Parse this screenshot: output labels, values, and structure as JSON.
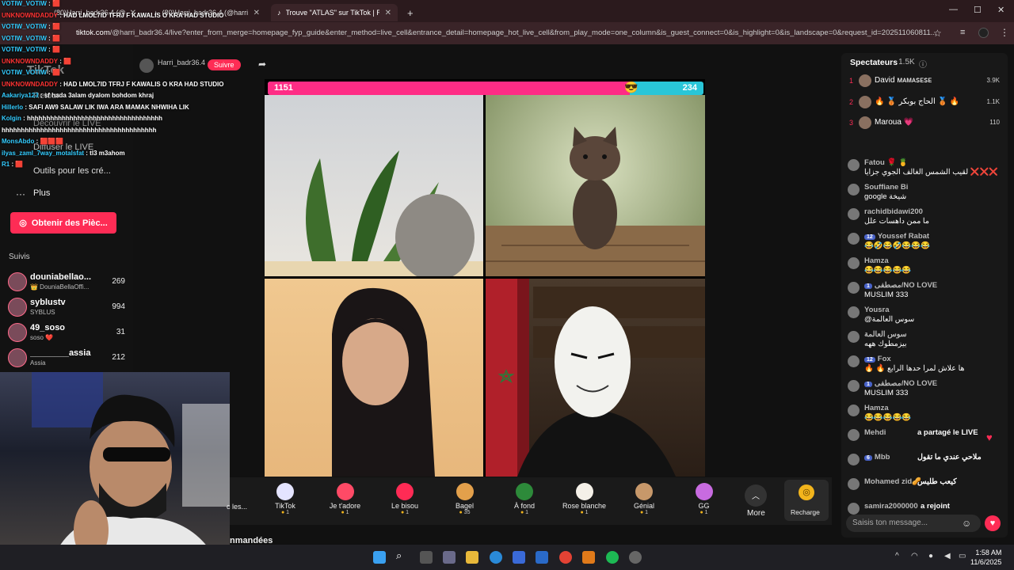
{
  "browser": {
    "tabs": [
      {
        "label": "(80)Harri_badr36.4 (@harri_badr"
      },
      {
        "label": "(80)Harri_badr36.4 (@harri_bad"
      },
      {
        "label": "Trouve \"ATLAS\" sur TikTok | Rech"
      }
    ],
    "url_host": "tiktok.com",
    "url_rest": "/@harri_badr36.4/live?enter_from_merge=homepage_fyp_guide&enter_method=live_cell&entrance_detail=homepage_hot_live_cell&from_play_mode=one_column&is_guest_connect=0&is_highlight=0&is_landscape=0&request_id=202511060811..."
  },
  "sidebar": {
    "logo": "TikTok",
    "back": "Retour",
    "discover": "Découvrir le LIVE",
    "broadcast": "Diffuser le LIVE",
    "tools": "Outils pour les cré...",
    "more": "Plus",
    "coins_button": "Obtenir des Pièc...",
    "following_title": "Suivis",
    "following": [
      {
        "name": "douniabellao...",
        "sub": "👑 DouniaBellaOffi...",
        "count": "269"
      },
      {
        "name": "syblustv",
        "sub": "SYBLUS",
        "count": "994"
      },
      {
        "name": "49_soso",
        "sub": "soso ❤️",
        "count": "31"
      },
      {
        "name": "________assia",
        "sub": "Assia",
        "count": "212"
      }
    ]
  },
  "overlay_chat": [
    {
      "user": "VOTIW_VOTIW",
      "msg": ": 🟥",
      "red": false
    },
    {
      "user": "UNKNOWNDADDY",
      "msg": ": HAD LMOL7ID TFRJ F KAWALIS O KRA HAD STUDIO",
      "red": true
    },
    {
      "user": "VOTIW_VOTIW",
      "msg": ": 🟥",
      "red": false
    },
    {
      "user": "VOTIW_VOTIW",
      "msg": ": 🟥",
      "red": false
    },
    {
      "user": "VOTIW_VOTIW",
      "msg": ": 🟥",
      "red": false
    },
    {
      "user": "UNKNOWNDADDY",
      "msg": ": 🟥",
      "red": true
    },
    {
      "user": "VOTIW_VOTIW",
      "msg": ": 🟥",
      "red": false
    },
    {
      "user": "UNKNOWNDADDY",
      "msg": ": HAD LMOL7ID TFRJ F KAWALIS O KRA HAD STUDIO",
      "red": true
    },
    {
      "user": "Aakariya123",
      "msg": ": sf hada 3alam dyalom bohdom khraj",
      "red": false
    },
    {
      "user": "Hillerlo",
      "msg": ": SAFI AW9 SALAW LIK IWA ARA MAMAK NHWIHA LIK",
      "red": false
    },
    {
      "user": "Kolgin",
      "msg": ": hhhhhhhhhhhhhhhhhhhhhhhhhhhhhhhhhhh",
      "red": false
    },
    {
      "user": "",
      "msg": "hhhhhhhhhhhhhhhhhhhhhhhhhhhhhhhhhhhhhhhh",
      "red": false
    },
    {
      "user": "MonsAbdo",
      "msg": ": 🟥🟥🟥",
      "red": false
    },
    {
      "user": "ilyas_zaml_7way_motalsfat",
      "msg": ": tl3 m3ahom",
      "red": false
    },
    {
      "user": "R1",
      "msg": ": 🟥",
      "red": false
    }
  ],
  "stream": {
    "host": "Harri_badr36.4",
    "follow_label": "Suivre",
    "score_left": "1151",
    "score_right": "234",
    "score_left_fraction": 0.83
  },
  "gifts": [
    {
      "name": "TikTok",
      "price": "1",
      "color": "#e4e4ff"
    },
    {
      "name": "Je t'adore",
      "price": "1",
      "color": "#ff4a66"
    },
    {
      "name": "Le bisou",
      "price": "1",
      "color": "#ff2b55"
    },
    {
      "name": "Bagel",
      "price": "35",
      "color": "#e3a04b"
    },
    {
      "name": "À fond",
      "price": "1",
      "color": "#2d8a3a"
    },
    {
      "name": "Rose blanche",
      "price": "1",
      "color": "#f4f0e8"
    },
    {
      "name": "Génial",
      "price": "1",
      "color": "#c7986a"
    },
    {
      "name": "GG",
      "price": "1",
      "color": "#c86be0"
    }
  ],
  "gift_partial": "c les...",
  "more_label": "More",
  "recharge_label": "Recharge",
  "bottom_text": "nmandées",
  "viewers": {
    "title": "Spectateurs",
    "count": "1.5K",
    "top": [
      {
        "rank": "1",
        "name": "David ᴍᴀᴍᴀꜱᴇꜱᴇ",
        "score": "3.9K"
      },
      {
        "rank": "2",
        "name": "🔥 🥉 الحاج بوبكر 🥉 🔥",
        "score": "1.1K"
      },
      {
        "rank": "3",
        "name": "Maroua 💗",
        "score": "110"
      }
    ]
  },
  "comments": [
    {
      "name": "Fatou 🌹 🍍",
      "text": "لقيب الشمس الغالف الجوي جزايا ❌❌❌",
      "badge": ""
    },
    {
      "name": "Souffiane Bi",
      "text": "google شيخة",
      "badge": ""
    },
    {
      "name": "rachidbidawi200",
      "text": "ما ممن داهسات علل",
      "badge": ""
    },
    {
      "name": "Youssef Rabat",
      "text": "😂🤣😂🤣😂😂😂",
      "badge": "12"
    },
    {
      "name": "Hamza",
      "text": "😂😂😂😂😂",
      "badge": ""
    },
    {
      "name": "مصطفى/NO LOVE",
      "text": "MUSLIM 333",
      "badge": "1"
    },
    {
      "name": "Yousra",
      "text": "@سوس العالمة",
      "badge": ""
    },
    {
      "name": "سوس العالمة",
      "text": "بيزمطوك ههه",
      "badge": ""
    },
    {
      "name": "Fox",
      "text": "🔥 🔥 ها علاش لمرا حدها الرابع",
      "badge": "12"
    },
    {
      "name": "مصطفى/NO LOVE",
      "text": "MUSLIM 333",
      "badge": "1"
    },
    {
      "name": "Hamza",
      "text": "😂😂😂😂😂",
      "badge": ""
    },
    {
      "name": "Mehdi",
      "text": "a partagé le LIVE",
      "badge": ""
    },
    {
      "name": "Mbb",
      "text": "ملاحي عندي ما تقول",
      "badge": "6"
    },
    {
      "name": "Mohamed zid🥜",
      "text": "كيعب طليس",
      "badge": ""
    },
    {
      "name": "samira2000000",
      "text": "a rejoint",
      "badge": ""
    }
  ],
  "message_placeholder": "Saisis ton message...",
  "clock": {
    "time": "1:58 AM",
    "date": "11/6/2025"
  },
  "colors": {
    "accent": "#fe2c55",
    "blue_bar": "#29c6d8",
    "pink_bar": "#fe2c85"
  }
}
